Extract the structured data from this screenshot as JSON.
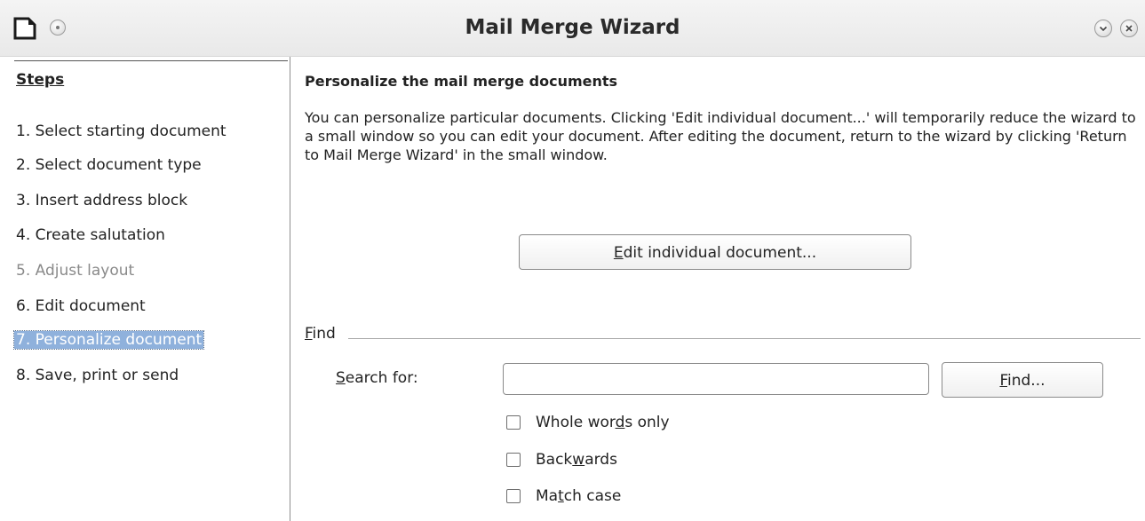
{
  "window": {
    "title": "Mail Merge Wizard"
  },
  "steps": {
    "heading": "Steps",
    "items": [
      {
        "label": "1. Select starting document",
        "state": "normal"
      },
      {
        "label": "2. Select document type",
        "state": "normal"
      },
      {
        "label": "3. Insert address block",
        "state": "normal"
      },
      {
        "label": "4. Create salutation",
        "state": "normal"
      },
      {
        "label": "5. Adjust layout",
        "state": "disabled"
      },
      {
        "label": "6. Edit document",
        "state": "normal"
      },
      {
        "label": "7. Personalize document",
        "state": "active"
      },
      {
        "label": "8. Save, print or send",
        "state": "normal"
      }
    ]
  },
  "main": {
    "heading": "Personalize the mail merge documents",
    "description": "You can personalize particular documents. Clicking 'Edit individual document...' will temporarily reduce the wizard to a small window so you can edit your document. After editing the document, return to the wizard by clicking 'Return to Mail Merge Wizard' in the small window.",
    "edit_button": {
      "mnemonic": "E",
      "rest": "dit individual document..."
    }
  },
  "find": {
    "frame_label": {
      "mnemonic": "F",
      "rest": "ind"
    },
    "search_label": {
      "mnemonic": "S",
      "rest": "earch for:"
    },
    "search_value": "",
    "find_button": {
      "mnemonic": "F",
      "rest": "ind..."
    },
    "options": {
      "whole_words": {
        "pre": "Whole wor",
        "mnemonic": "d",
        "post": "s only",
        "checked": false
      },
      "backwards": {
        "pre": "Back",
        "mnemonic": "w",
        "post": "ards",
        "checked": false
      },
      "match_case": {
        "pre": "Ma",
        "mnemonic": "t",
        "post": "ch case",
        "checked": false
      }
    }
  },
  "colors": {
    "selection": "#8fb1dc",
    "disabled_text": "#8a8a8a"
  }
}
